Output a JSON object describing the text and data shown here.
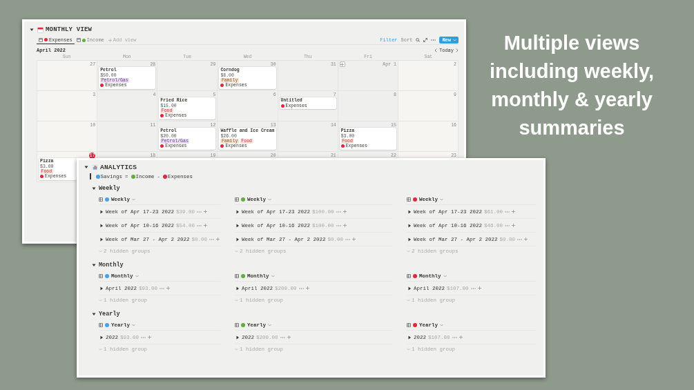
{
  "headline": "Multiple views\nincluding weekly,\nmonthly & yearly\nsummaries",
  "monthly_view": {
    "title": "MONTHLY VIEW",
    "expanded": true,
    "tabs": [
      {
        "label": "Expenses",
        "color": "#e0263f",
        "selected": true
      },
      {
        "label": "Income",
        "color": "#5fad3f",
        "selected": false
      }
    ],
    "add_view": "Add view",
    "toolbar": {
      "filter": "Filter",
      "sort": "Sort",
      "new": "New"
    },
    "month": "April 2022",
    "today": "Today",
    "weekdays": [
      "Sun",
      "Mon",
      "Tue",
      "Wed",
      "Thu",
      "Fri",
      "Sat"
    ],
    "weeks": [
      {
        "days": [
          {
            "date": "27"
          },
          {
            "date": "28",
            "cards": [
              {
                "title": "Petrol",
                "amount": "$50.00",
                "tags": [
                  {
                    "label": "Petrol/Gas",
                    "kind": "purple"
                  }
                ],
                "database": "Expenses",
                "color": "#e0263f"
              }
            ]
          },
          {
            "date": "29"
          },
          {
            "date": "30",
            "cards": [
              {
                "title": "Corndog",
                "amount": "$8.00",
                "tags": [
                  {
                    "label": "Family",
                    "kind": "orange"
                  }
                ],
                "database": "Expenses",
                "color": "#e0263f"
              }
            ]
          },
          {
            "date": "31"
          },
          {
            "date": "Apr 1",
            "add_button": true
          },
          {
            "date": "2"
          }
        ]
      },
      {
        "days": [
          {
            "date": "3"
          },
          {
            "date": "4"
          },
          {
            "date": "5",
            "cards": [
              {
                "title": "Fried Rice",
                "amount": "$15.00",
                "tags": [
                  {
                    "label": "Food",
                    "kind": "red"
                  }
                ],
                "database": "Expenses",
                "color": "#e0263f"
              }
            ]
          },
          {
            "date": "6"
          },
          {
            "date": "7",
            "cards": [
              {
                "title": "Untitled",
                "database": "Expenses",
                "color": "#e0263f"
              }
            ]
          },
          {
            "date": "8"
          },
          {
            "date": "9"
          }
        ]
      },
      {
        "days": [
          {
            "date": "10"
          },
          {
            "date": "11"
          },
          {
            "date": "12",
            "cards": [
              {
                "title": "Petrol",
                "amount": "$20.00",
                "tags": [
                  {
                    "label": "Petrol/Gas",
                    "kind": "purple"
                  }
                ],
                "database": "Expenses",
                "color": "#e0263f"
              }
            ]
          },
          {
            "date": "13",
            "cards": [
              {
                "title": "Waffle and Ice Cream",
                "amount": "$26.00",
                "tags": [
                  {
                    "label": "Family",
                    "kind": "orange"
                  },
                  {
                    "label": "Food",
                    "kind": "red"
                  }
                ],
                "database": "Expenses",
                "color": "#e0263f"
              }
            ]
          },
          {
            "date": "14"
          },
          {
            "date": "15",
            "cards": [
              {
                "title": "Pizza",
                "amount": "$3.00",
                "tags": [
                  {
                    "label": "Food",
                    "kind": "red"
                  }
                ],
                "database": "Expenses",
                "color": "#e0263f"
              }
            ]
          },
          {
            "date": "16"
          }
        ]
      },
      {
        "days": [
          {
            "date": "17",
            "today": true,
            "cards": [
              {
                "title": "Pizza",
                "amount": "$3.00",
                "tags": [
                  {
                    "label": "Food",
                    "kind": "red"
                  }
                ],
                "database": "Expenses",
                "color": "#e0263f"
              }
            ]
          },
          {
            "date": "18"
          },
          {
            "date": "19"
          },
          {
            "date": "20"
          },
          {
            "date": "21"
          },
          {
            "date": "22"
          },
          {
            "date": "23"
          }
        ]
      }
    ]
  },
  "analytics": {
    "title": "ANALYTICS",
    "expanded": true,
    "formula": [
      {
        "kind": "term",
        "label": "Savings",
        "color": "#4aa0e6"
      },
      {
        "kind": "op",
        "label": "="
      },
      {
        "kind": "term",
        "label": "Income",
        "color": "#5fad3f"
      },
      {
        "kind": "op",
        "label": "-"
      },
      {
        "kind": "term",
        "label": "Expenses",
        "color": "#e0263f"
      }
    ],
    "sections": [
      {
        "title": "Weekly",
        "expanded": true,
        "views": [
          {
            "label": "Weekly",
            "color": "#4aa0e6",
            "groups": [
              {
                "label": "Week of Apr 17-23 2022",
                "amount": "$39.00"
              },
              {
                "label": "Week of Apr 10-16 2022",
                "amount": "$54.00"
              },
              {
                "label": "Week of Mar 27 - Apr 2 2022",
                "amount": "$0.00"
              }
            ],
            "hidden": "2 hidden groups"
          },
          {
            "label": "Weekly",
            "color": "#5fad3f",
            "groups": [
              {
                "label": "Week of Apr 17-23 2022",
                "amount": "$100.00"
              },
              {
                "label": "Week of Apr 10-16 2022",
                "amount": "$100.00"
              },
              {
                "label": "Week of Mar 27 - Apr 2 2022",
                "amount": "$0.00"
              }
            ],
            "hidden": "2 hidden groups"
          },
          {
            "label": "Weekly",
            "color": "#e0263f",
            "groups": [
              {
                "label": "Week of Apr 17-23 2022",
                "amount": "$61.00"
              },
              {
                "label": "Week of Apr 10-16 2022",
                "amount": "$46.00"
              },
              {
                "label": "Week of Mar 27 - Apr 2 2022",
                "amount": "$0.00"
              }
            ],
            "hidden": "2 hidden groups"
          }
        ]
      },
      {
        "title": "Monthly",
        "expanded": true,
        "views": [
          {
            "label": "Monthly",
            "color": "#4aa0e6",
            "groups": [
              {
                "label": "April 2022",
                "amount": "$93.00"
              }
            ],
            "hidden": "1 hidden group"
          },
          {
            "label": "Monthly",
            "color": "#5fad3f",
            "groups": [
              {
                "label": "April 2022",
                "amount": "$200.00"
              }
            ],
            "hidden": "1 hidden group"
          },
          {
            "label": "Monthly",
            "color": "#e0263f",
            "groups": [
              {
                "label": "April 2022",
                "amount": "$107.00"
              }
            ],
            "hidden": "1 hidden group"
          }
        ]
      },
      {
        "title": "Yearly",
        "expanded": true,
        "views": [
          {
            "label": "Yearly",
            "color": "#4aa0e6",
            "groups": [
              {
                "label": "2022",
                "amount": "$93.00"
              }
            ],
            "hidden": "1 hidden group"
          },
          {
            "label": "Yearly",
            "color": "#5fad3f",
            "groups": [
              {
                "label": "2022",
                "amount": "$200.00"
              }
            ],
            "hidden": "1 hidden group"
          },
          {
            "label": "Yearly",
            "color": "#e0263f",
            "groups": [
              {
                "label": "2022",
                "amount": "$107.00"
              }
            ],
            "hidden": "1 hidden group"
          }
        ]
      }
    ]
  }
}
